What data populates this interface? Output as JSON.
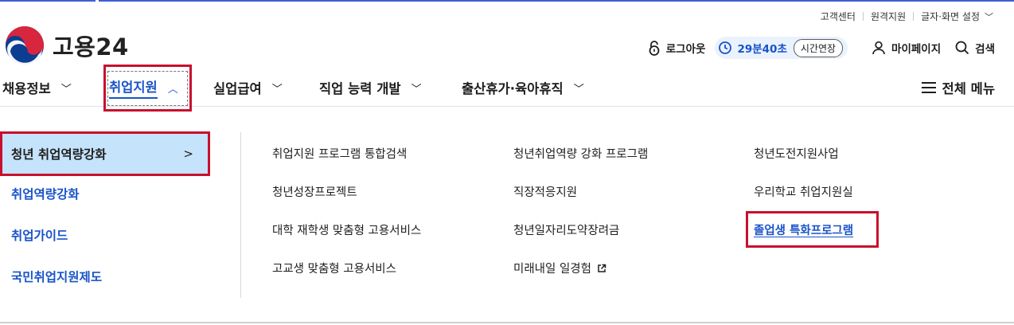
{
  "utility": {
    "items": [
      "고객센터",
      "원격지원",
      "글자·화면 설정"
    ]
  },
  "logo": {
    "text": "고용24"
  },
  "header": {
    "logout": "로그아웃",
    "timer": "29분40초",
    "extend": "시간연장",
    "mypage": "마이페이지",
    "search": "검색"
  },
  "gnb": {
    "items": [
      "채용정보",
      "취업지원",
      "실업급여",
      "직업 능력 개발",
      "출산휴가·육아휴직"
    ],
    "all_menu": "전체 메뉴"
  },
  "submenu": {
    "left": [
      "청년 취업역량강화",
      "취업역량강화",
      "취업가이드",
      "국민취업지원제도"
    ],
    "col1": [
      "취업지원 프로그램 통합검색",
      "청년성장프로젝트",
      "대학 재학생 맞춤형 고용서비스",
      "고교생 맞춤형 고용서비스"
    ],
    "col2": [
      "청년취업역량 강화 프로그램",
      "직장적응지원",
      "청년일자리도약장려금",
      "미래내일 일경험"
    ],
    "col3": [
      "청년도전지원사업",
      "우리학교 취업지원실",
      "졸업생 특화프로그램"
    ]
  },
  "colors": {
    "brand_blue": "#1953c8",
    "highlight_red": "#c8102e",
    "selected_bg": "#c5e3fb",
    "timer_bg": "#eaf2fe"
  }
}
